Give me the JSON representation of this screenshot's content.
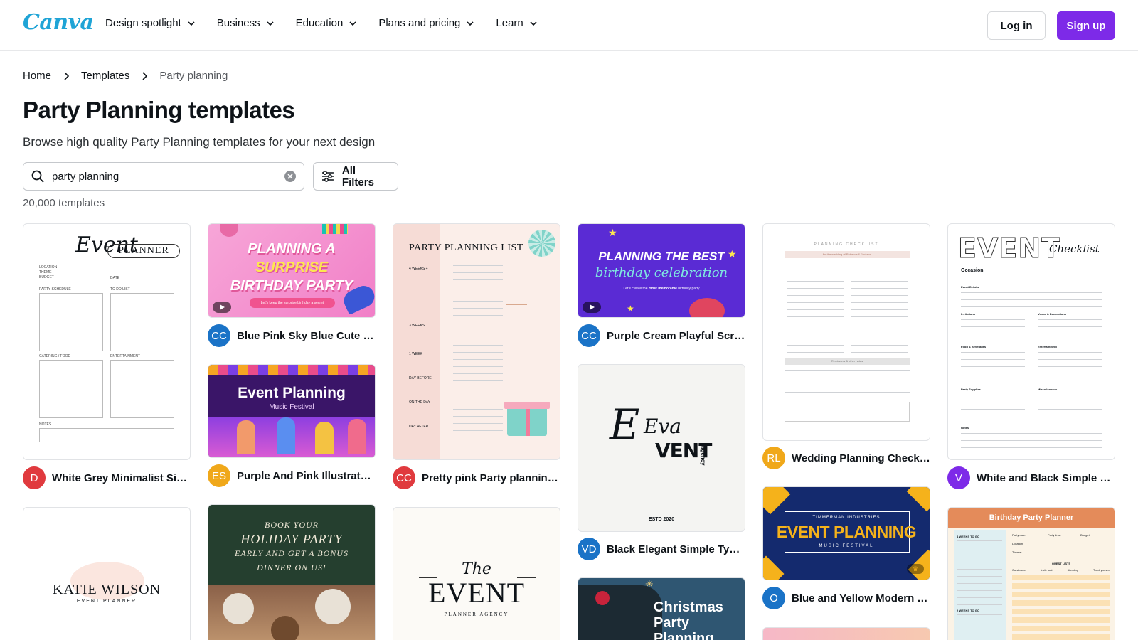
{
  "header": {
    "logo": "Canva",
    "nav": [
      "Design spotlight",
      "Business",
      "Education",
      "Plans and pricing",
      "Learn"
    ],
    "login": "Log in",
    "signup": "Sign up",
    "accent": "#7d2ae8"
  },
  "breadcrumb": [
    "Home",
    "Templates",
    "Party planning"
  ],
  "page": {
    "title": "Party Planning templates",
    "subtitle": "Browse high quality Party Planning templates for your next design",
    "count": "20,000 templates"
  },
  "search": {
    "value": "party planning",
    "filters_label": "All Filters"
  },
  "cards": [
    {
      "initials": "D",
      "avatar_color": "#e03a3e",
      "title": "White Grey Minimalist Simple Event Planner",
      "thumb": {
        "script": "Event",
        "word": "PLANNER",
        "labels": [
          "LOCATION",
          "THEME",
          "BUDGET",
          "DATE",
          "PARTY SCHEDULE",
          "TO DO LIST",
          "CATERING / FOOD",
          "ENTERTAINMENT",
          "NOTES"
        ]
      }
    },
    {
      "initials": "CC",
      "avatar_color": "#1a73c7",
      "title": "Blue Pink Sky Blue Cute Illustrative Birthday Party",
      "thumb": {
        "line1": "PLANNING A",
        "line2": "SURPRISE",
        "line3": "BIRTHDAY PARTY",
        "pill": "Let's keep the surprise birthday a secret"
      }
    },
    {
      "initials": "ES",
      "avatar_color": "#f0a81a",
      "title": "Purple And Pink Illustrated Music Festival",
      "thumb": {
        "title": "Event Planning",
        "sub": "Music Festival"
      }
    },
    {
      "initials": "CC",
      "avatar_color": "#e03a3e",
      "title": "Pretty pink Party planning list",
      "thumb": {
        "title": "PARTY PLANNING LIST",
        "sections": [
          "4 WEEKS +",
          "3 WEEKS",
          "1 WEEK",
          "DAY BEFORE",
          "ON THE DAY",
          "DAY AFTER"
        ]
      }
    },
    {
      "initials": "CC",
      "avatar_color": "#1a73c7",
      "title": "Purple Cream Playful Scrapbook Birthday",
      "thumb": {
        "line1": "PLANNING THE BEST",
        "line2": "birthday celebration",
        "sub_pre": "Let's create the",
        "sub_bold": "most memorable",
        "sub_post": "birthday party"
      }
    },
    {
      "initials": "VD",
      "avatar_color": "#1a73c7",
      "title": "Black Elegant Simple Typography Event Agency",
      "thumb": {
        "big": "Eva",
        "word": "VENT",
        "side": "agency",
        "footer": "ESTD 2020"
      }
    },
    {
      "initials": "RL",
      "avatar_color": "#f0a81a",
      "title": "Wedding Planning Checklist Planner",
      "thumb": {
        "title": "PLANNING CHECKLIST",
        "sub": "for the wedding of Rebecca & Jackson",
        "footer": "Reminders & other notes"
      }
    },
    {
      "initials": "O",
      "avatar_color": "#1a73c7",
      "title": "Blue and Yellow Modern Event Planning",
      "thumb": {
        "top": "TIMMERMAN INDUSTRIES",
        "title": "EVENT PLANNING",
        "sub": "MUSIC FESTIVAL"
      }
    },
    {
      "initials": "V",
      "avatar_color": "#7d2ae8",
      "title": "White and Black Simple Event Checklist",
      "thumb": {
        "big": "EVENT",
        "script": "Checklist",
        "occasion": "Occasion",
        "heads": [
          "Event Details",
          "Invitations",
          "Venue & Decorations",
          "Food & Beverages",
          "Entertainment",
          "Party Supplies",
          "Miscellaneous",
          "Notes"
        ]
      }
    },
    {
      "thumb": {
        "name": "KATIE WILSON",
        "role": "EVENT PLANNER"
      }
    },
    {
      "thumb": {
        "l1": "BOOK YOUR",
        "l2": "HOLIDAY PARTY",
        "l3": "EARLY AND GET A BONUS",
        "l4": "DINNER ON US!"
      }
    },
    {
      "thumb": {
        "script": "The",
        "big": "EVENT",
        "sub": "PLANNER AGENCY"
      }
    },
    {
      "thumb": {
        "title": "Christmas Party Planning"
      }
    },
    {
      "thumb": {
        "title": "Birthday Party Planner",
        "fields": [
          "Party date:",
          "Party time:",
          "Budget:",
          "Location:",
          "Theme:"
        ],
        "sections": [
          "4 WEEKS TO GO",
          "2 WEEKS TO GO"
        ],
        "guest": "GUEST LISTS",
        "cols": [
          "Guest name",
          "Invite sent",
          "Attending",
          "Thank you sent"
        ]
      }
    }
  ]
}
